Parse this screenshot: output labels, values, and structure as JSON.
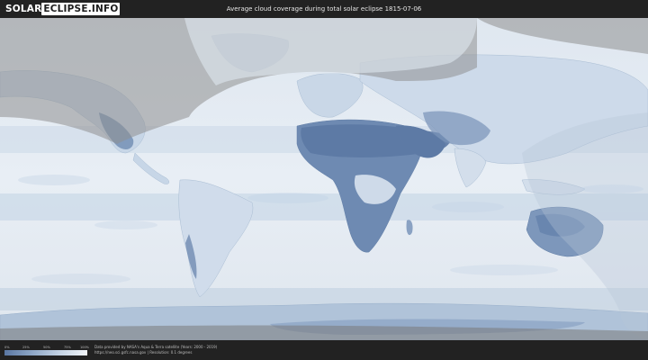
{
  "header": {
    "logo_left": "SOLAR",
    "logo_right": "ECLIPSE.INFO",
    "title": "Average cloud coverage during total solar eclipse 1815-07-06"
  },
  "legend": {
    "ticks": [
      "0%",
      "25%",
      "50%",
      "75%",
      "100%"
    ],
    "colors": [
      "#5a77a3",
      "#8ea7c7",
      "#c4d3e4",
      "#f2f5f9"
    ]
  },
  "footer": {
    "credit_line": "Data provided by NASA's Aqua & Terra satellite (Years: 2000 - 2019)",
    "source_line": "https://neo.sci.gsfc.nasa.gov | Resolution: 0.1 degrees"
  },
  "colors": {
    "clear_sky": "#5f7ea8",
    "cloudy": "#f1f4f8",
    "night_shade": "#8f8f8f",
    "background": "#1f1f1f"
  }
}
